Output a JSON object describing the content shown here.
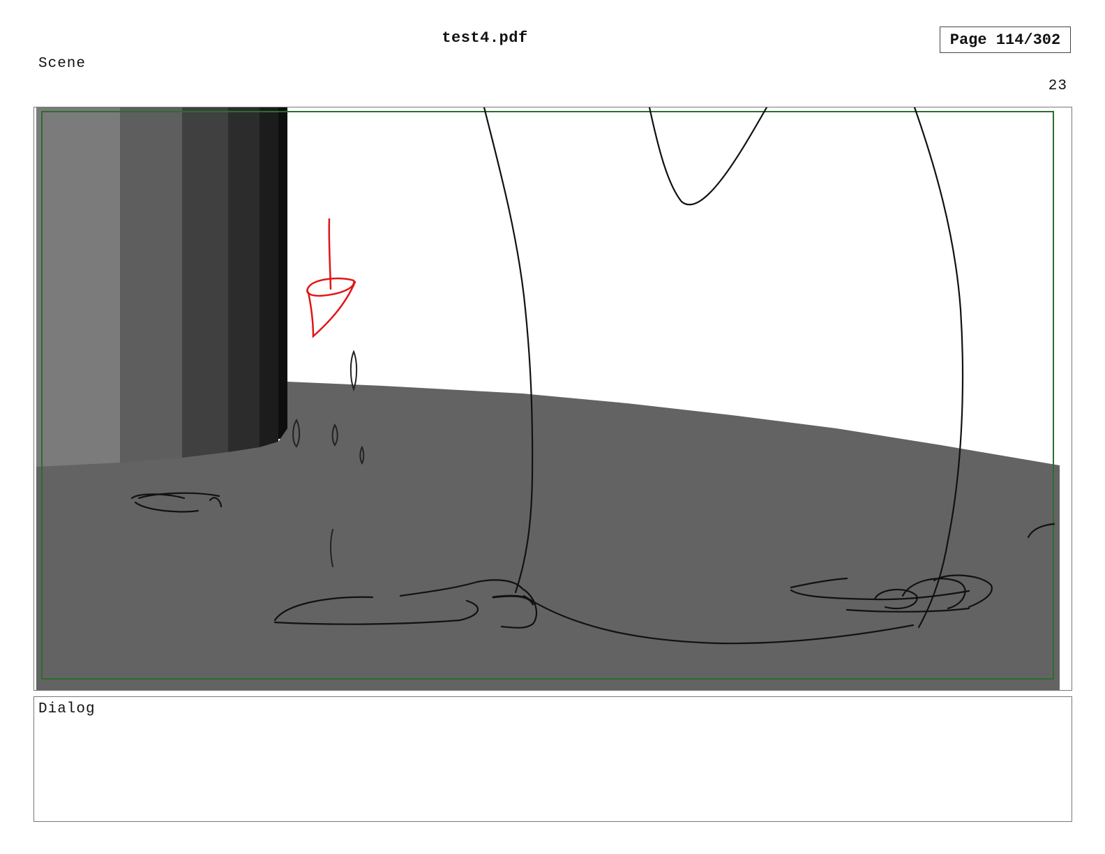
{
  "header": {
    "document_title": "test4.pdf",
    "page_indicator": "Page 114/302"
  },
  "scene": {
    "label": "Scene",
    "panel_number": "23"
  },
  "dialog": {
    "label": "Dialog"
  },
  "colors": {
    "safe_frame": "#2d6b2d",
    "red_sketch": "#e01515",
    "floor": "#636363",
    "sketch_line": "#111111"
  }
}
